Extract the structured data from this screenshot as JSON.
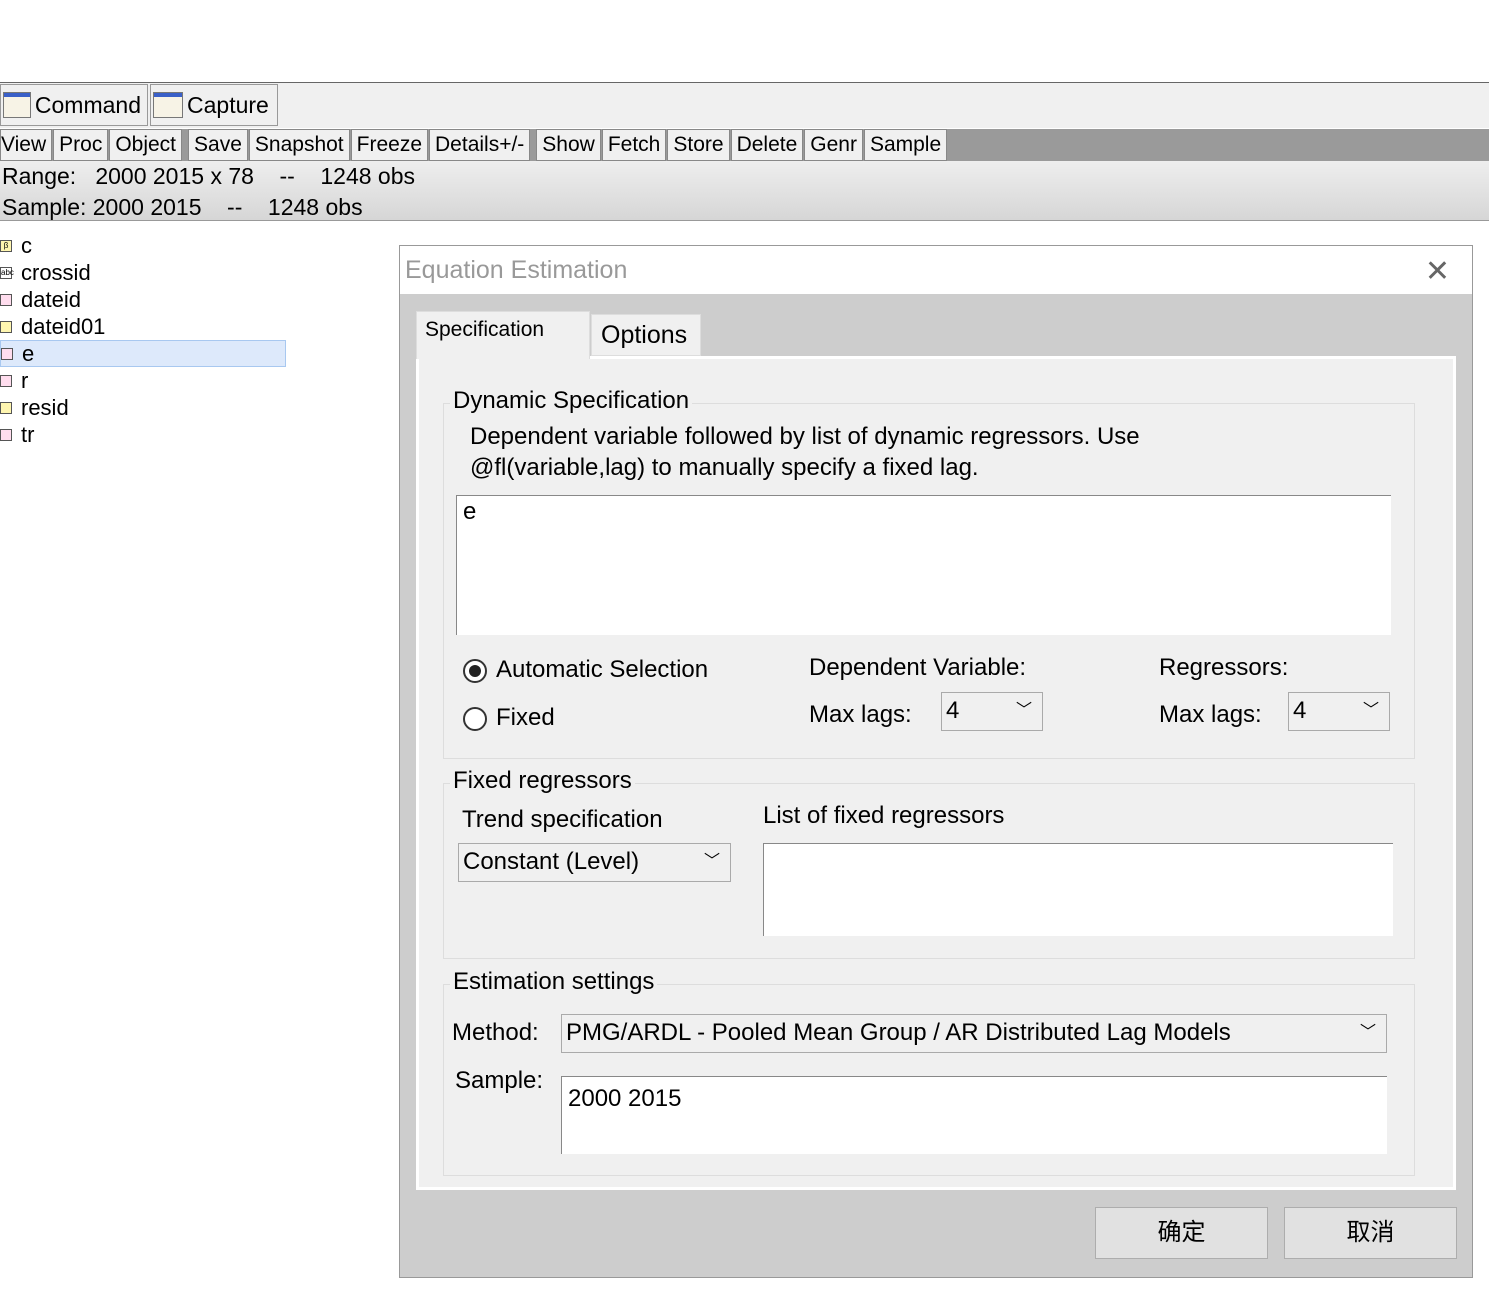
{
  "window_tabs": [
    "Command",
    "Capture"
  ],
  "toolbar": [
    "View",
    "Proc",
    "Object",
    "Save",
    "Snapshot",
    "Freeze",
    "Details+/-",
    "Show",
    "Fetch",
    "Store",
    "Delete",
    "Genr",
    "Sample"
  ],
  "info": {
    "range": "Range:   2000 2015 x 78    --    1248 obs",
    "sample": "Sample: 2000 2015    --    1248 obs"
  },
  "workfile": [
    {
      "name": "c",
      "icon": "coef-icon"
    },
    {
      "name": "crossid",
      "icon": "alpha-icon"
    },
    {
      "name": "dateid",
      "icon": "series-icon"
    },
    {
      "name": "dateid01",
      "icon": "series-icon"
    },
    {
      "name": "e",
      "icon": "series-icon",
      "selected": true
    },
    {
      "name": "r",
      "icon": "series-icon"
    },
    {
      "name": "resid",
      "icon": "series-icon"
    },
    {
      "name": "tr",
      "icon": "series-icon"
    }
  ],
  "dialog": {
    "title": "Equation Estimation",
    "tabs": [
      "Specification",
      "Options"
    ],
    "dynamic": {
      "label": "Dynamic Specification",
      "desc1": "Dependent variable followed by list of dynamic regressors. Use",
      "desc2": "@fl(variable,lag) to manually specify a fixed lag.",
      "value": "e",
      "auto": "Automatic Selection",
      "fixed": "Fixed",
      "dep_label": "Dependent Variable:",
      "reg_label": "Regressors:",
      "maxlags": "Max lags:",
      "dep_maxlags": "4",
      "reg_maxlags": "4"
    },
    "fixed_regs": {
      "label": "Fixed regressors",
      "trend_label": "Trend specification",
      "trend_value": "Constant (Level)",
      "list_label": "List of fixed regressors",
      "list_value": ""
    },
    "estimation": {
      "label": "Estimation settings",
      "method_label": "Method:",
      "method_value": "PMG/ARDL  -  Pooled Mean Group / AR Distributed Lag Models",
      "sample_label": "Sample:",
      "sample_value": "2000 2015"
    },
    "ok": "确定",
    "cancel": "取消"
  }
}
